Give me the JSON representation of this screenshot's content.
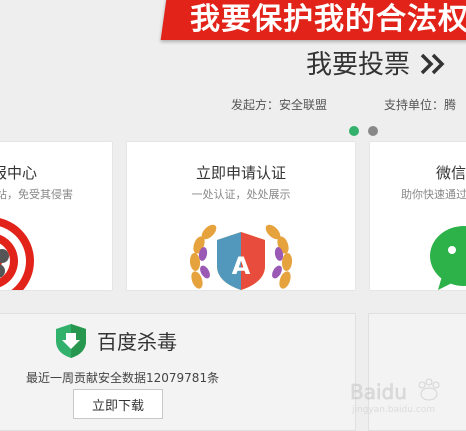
{
  "banner": {
    "text": "我要保护我的合法权"
  },
  "vote": {
    "label": "我要投票",
    "arrow_icon": "double-chevron-right-icon"
  },
  "sponsors": {
    "initiator": "发起方：安全联盟",
    "supporter": "支持单位：腾"
  },
  "carousel": {
    "colors": [
      "#32b16c",
      "#888888"
    ],
    "active_index": 0
  },
  "cards": [
    {
      "title": "报中心",
      "subtitle": "站，免受其侵害"
    },
    {
      "title": "立即申请认证",
      "subtitle": "一处认证，处处展示"
    },
    {
      "title": "微信",
      "subtitle": "助你快速通过"
    }
  ],
  "antivirus": {
    "name": "百度杀毒",
    "stat": "最近一周贡献安全数据12079781条",
    "download": "立即下载"
  },
  "badge_letter": "A",
  "watermark": {
    "text": "Baidu",
    "sub": "jingyan.baidu.com"
  },
  "colors": {
    "red": "#e2231a",
    "green": "#32b16c",
    "wechat": "#2db24a"
  }
}
